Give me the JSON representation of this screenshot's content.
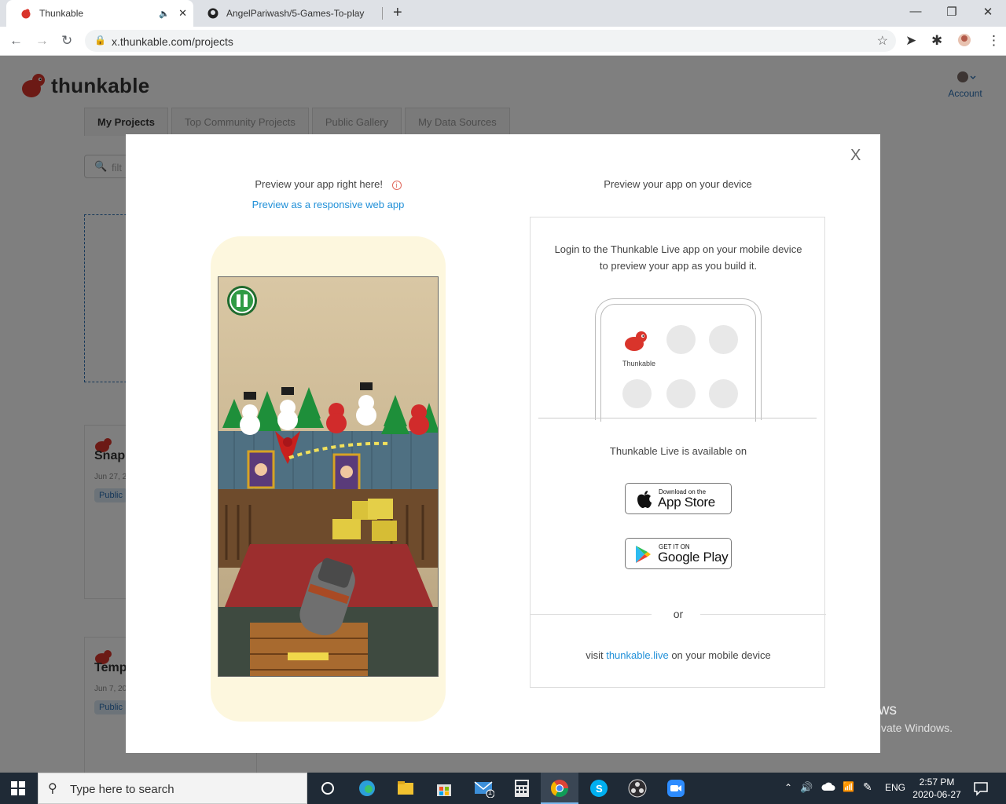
{
  "browser": {
    "tabs": [
      {
        "title": "Thunkable",
        "active": true
      },
      {
        "title": "AngelPariwash/5-Games-To-play",
        "active": false
      }
    ],
    "new_tab_symbol": "+",
    "url": "x.thunkable.com/projects",
    "window_controls": [
      "—",
      "❐",
      "✕"
    ]
  },
  "header": {
    "logo_text": "thunkable",
    "account_label": "Account"
  },
  "page_tabs": [
    "My Projects",
    "Top Community Projects",
    "Public Gallery",
    "My Data Sources"
  ],
  "filter_placeholder": "filt",
  "cards": [
    {
      "title": "Snap",
      "date": "Jun 27, 2",
      "badge": "Public"
    },
    {
      "title": "Temp",
      "date": "Jun 7, 20",
      "badge": "Public"
    }
  ],
  "modal": {
    "close_symbol": "X",
    "left_title": "Preview your app right here!",
    "left_info_icon": "i",
    "left_link": "Preview as a responsive web app",
    "right_title": "Preview your app on your device",
    "login_text": "Login to the Thunkable Live app on your mobile device to preview your app as you build it.",
    "mock_app_label": "Thunkable",
    "available_text": "Thunkable Live is available on",
    "app_store": {
      "small": "Download on the",
      "big": "App Store"
    },
    "google_play": {
      "small": "GET IT ON",
      "big": "Google Play"
    },
    "or_text": "or",
    "visit_prefix": "visit ",
    "visit_link": "thunkable.live",
    "visit_suffix": " on your mobile device"
  },
  "watermark": {
    "line1": "Activate Windows",
    "line2": "Go to Settings to activate Windows."
  },
  "taskbar": {
    "search_placeholder": "Type here to search",
    "language": "ENG",
    "time": "2:57 PM",
    "date": "2020-06-27",
    "mail_badge": "1"
  },
  "colors": {
    "brand_red": "#d9342b",
    "link_blue": "#2190d8",
    "taskbar": "#1f2a36"
  }
}
